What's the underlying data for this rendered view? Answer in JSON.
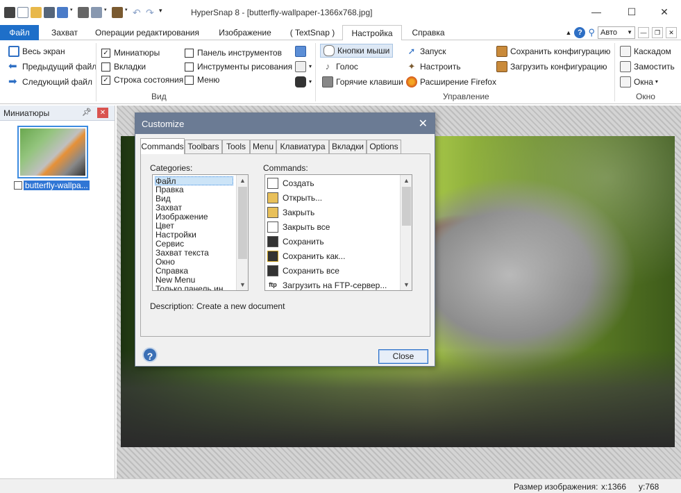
{
  "window": {
    "title": "HyperSnap 8 - [butterfly-wallpaper-1366x768.jpg]"
  },
  "tabs": [
    {
      "label": "Файл"
    },
    {
      "label": "Захват"
    },
    {
      "label": "Операции редактирования"
    },
    {
      "label": "Изображение"
    },
    {
      "label": "( TextSnap )"
    },
    {
      "label": "Настройка"
    },
    {
      "label": "Справка"
    }
  ],
  "tabs_right": {
    "zoom_value": "Авто"
  },
  "ribbon": {
    "nav": [
      {
        "label": "Весь экран"
      },
      {
        "label": "Предыдущий файл"
      },
      {
        "label": "Следующий файл"
      }
    ],
    "view_checks": [
      {
        "label": "Миниатюры",
        "checked": true
      },
      {
        "label": "Вкладки",
        "checked": false
      },
      {
        "label": "Строка состояния",
        "checked": true
      },
      {
        "label": "Панель инструментов",
        "checked": false
      },
      {
        "label": "Инструменты рисования",
        "checked": false
      },
      {
        "label": "Меню",
        "checked": false
      }
    ],
    "view_group": "Вид",
    "manage": [
      {
        "label": "Кнопки мыши"
      },
      {
        "label": "Голос"
      },
      {
        "label": "Горячие клавиши"
      },
      {
        "label": "Запуск"
      },
      {
        "label": "Настроить"
      },
      {
        "label": "Расширение Firefox"
      },
      {
        "label": "Сохранить конфигурацию"
      },
      {
        "label": "Загрузить конфигурацию"
      }
    ],
    "manage_group": "Управление",
    "window_items": [
      {
        "label": "Каскадом"
      },
      {
        "label": "Замостить"
      },
      {
        "label": "Окна"
      }
    ],
    "window_group": "Окно"
  },
  "thumbpane": {
    "title": "Миниатюры",
    "thumb_label": "butterfly-wallpa..."
  },
  "status": {
    "size_label": "Размер изображения:",
    "x": "x:1366",
    "y": "y:768"
  },
  "dialog": {
    "title": "Customize",
    "tabs": [
      {
        "label": "Commands"
      },
      {
        "label": "Toolbars"
      },
      {
        "label": "Tools"
      },
      {
        "label": "Menu"
      },
      {
        "label": "Клавиатура"
      },
      {
        "label": "Вкладки"
      },
      {
        "label": "Options"
      }
    ],
    "categories_label": "Categories:",
    "categories": [
      "Файл",
      "Правка",
      "Вид",
      "Захват",
      "Изображение",
      "Цвет",
      "Настройки",
      "Сервис",
      "Захват текста",
      "Окно",
      "Справка",
      "New Menu",
      "Только панель ин"
    ],
    "commands_label": "Commands:",
    "commands": [
      {
        "label": "Создать",
        "icon": "new-document-icon"
      },
      {
        "label": "Открыть...",
        "icon": "open-folder-icon"
      },
      {
        "label": "Закрыть",
        "icon": "close-folder-icon"
      },
      {
        "label": "Закрыть все",
        "icon": "close-all-icon"
      },
      {
        "label": "Сохранить",
        "icon": "save-icon"
      },
      {
        "label": "Сохранить как...",
        "icon": "save-as-icon"
      },
      {
        "label": "Сохранить все",
        "icon": "save-all-icon"
      },
      {
        "label": "Загрузить на FTP-сервер...",
        "icon": "ftp-icon",
        "glyph": "ftp"
      }
    ],
    "description_label": "Description:",
    "description": "Create a new document",
    "close_label": "Close"
  }
}
